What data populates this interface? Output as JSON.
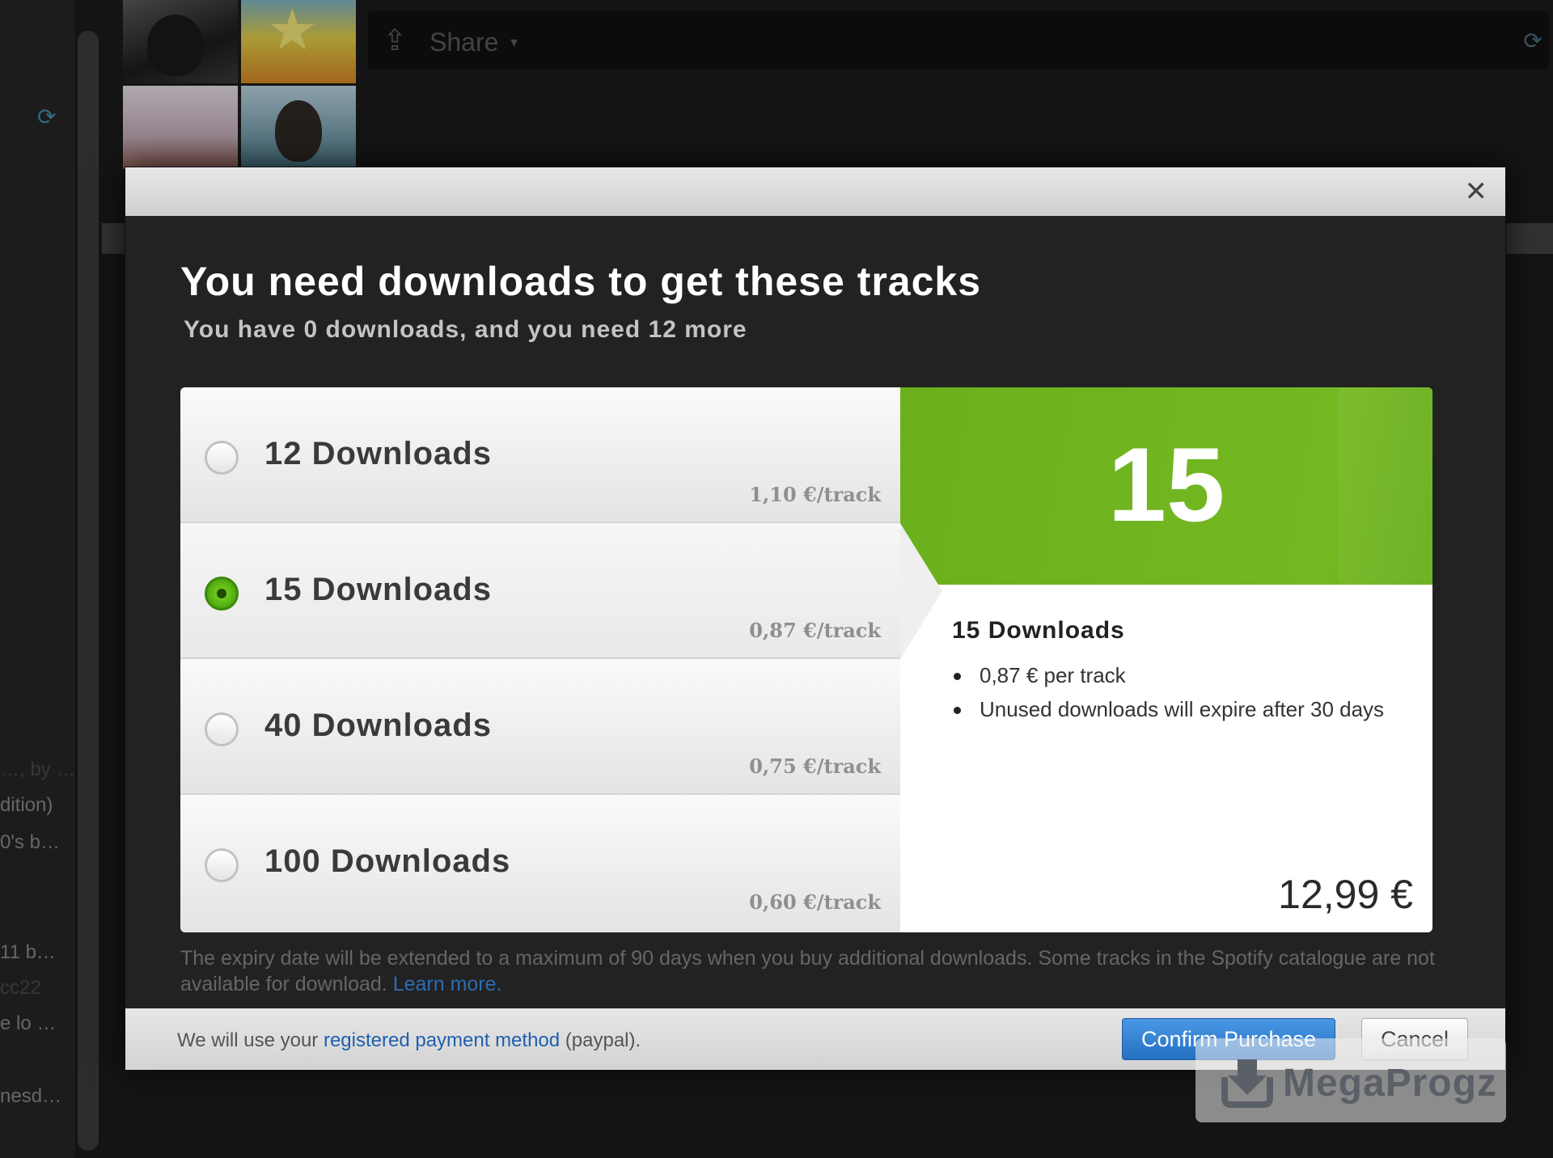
{
  "background": {
    "sidebar": {
      "texts": [
        {
          "text": "…, by …",
          "dim": true
        },
        {
          "text": "dition)",
          "dim": false
        },
        {
          "text": "0's b…",
          "dim": false
        },
        {
          "text": "11 b…",
          "dim": false
        },
        {
          "text": "cc22",
          "dim": true
        },
        {
          "text": "e lo …",
          "dim": false
        },
        {
          "text": "nesd…",
          "dim": false
        }
      ]
    },
    "toolbar": {
      "share_label": "Share",
      "share_caret": "▾"
    },
    "icons": {
      "sidebar_refresh": "refresh-icon",
      "toolbar_refresh": "refresh-icon",
      "share": "share-icon"
    }
  },
  "modal": {
    "close_glyph": "✕",
    "title": "You need downloads to get these tracks",
    "subtitle": "You have 0 downloads, and you need 12 more",
    "options": [
      {
        "label": "12 Downloads",
        "price": "1,10 €/track",
        "selected": false
      },
      {
        "label": "15 Downloads",
        "price": "0,87 €/track",
        "selected": true
      },
      {
        "label": "40 Downloads",
        "price": "0,75 €/track",
        "selected": false
      },
      {
        "label": "100 Downloads",
        "price": "0,60 €/track",
        "selected": false
      }
    ],
    "detail": {
      "count": "15",
      "title": "15 Downloads",
      "bullets": [
        "0,87 € per track",
        "Unused downloads will expire after 30 days"
      ],
      "price": "12,99 €"
    },
    "footnote": {
      "text": "The expiry date will be extended to a maximum of 90 days when you buy additional downloads. Some tracks in the Spotify catalogue are not available for download.",
      "link": "Learn more."
    },
    "footer": {
      "payment_prefix": "We will use your",
      "payment_link": "registered payment method",
      "payment_suffix": "(paypal).",
      "confirm_label": "Confirm Purchase",
      "cancel_label": "Cancel"
    }
  },
  "watermark": {
    "text": "MegaProgz"
  },
  "colors": {
    "accent_green": "#74b923",
    "confirm_blue": "#2470c2",
    "link_blue": "#2b6cb2"
  }
}
